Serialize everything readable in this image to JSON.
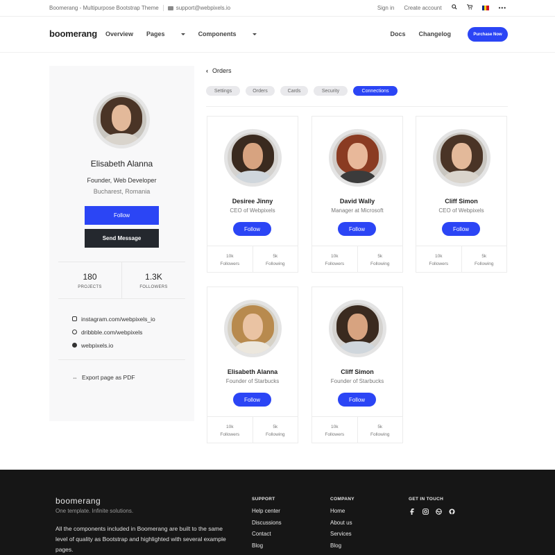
{
  "topbar": {
    "brand": "Boomerang - Multipurpose Bootstrap Theme",
    "email": "support@webpixels.io",
    "signin": "Sign in",
    "create": "Create account",
    "dots": "•••"
  },
  "navbar": {
    "logo": "boomerang",
    "links": [
      "Overview",
      "Pages",
      "Components"
    ],
    "right": [
      "Docs",
      "Changelog"
    ],
    "purchase": "Purchase Now"
  },
  "profile": {
    "name": "Elisabeth Alanna",
    "role": "Founder, Web Developer",
    "location": "Bucharest, Romania",
    "follow": "Follow",
    "message": "Send Message",
    "stats": [
      {
        "value": "180",
        "label": "PROJECTS"
      },
      {
        "value": "1.3K",
        "label": "FOLLOWERS"
      }
    ],
    "links": [
      "instagram.com/webpixels_io",
      "dribbble.com/webpixels",
      "webpixels.io"
    ],
    "export": "Export page as PDF"
  },
  "main": {
    "back": "Orders",
    "tabs": [
      "Settings",
      "Orders",
      "Cards",
      "Security",
      "Connections"
    ],
    "active_tab": "Connections",
    "cards": [
      {
        "name": "Desiree Jinny",
        "role": "CEO of Webpixels",
        "follow": "Follow",
        "followers": "10k",
        "followers_label": "Followers",
        "following": "5k",
        "following_label": "Following"
      },
      {
        "name": "David Wally",
        "role": "Manager at Microsoft",
        "follow": "Follow",
        "followers": "10k",
        "followers_label": "Followers",
        "following": "5k",
        "following_label": "Following"
      },
      {
        "name": "Cliff Simon",
        "role": "CEO of Webpixels",
        "follow": "Follow",
        "followers": "10k",
        "followers_label": "Followers",
        "following": "5k",
        "following_label": "Following"
      },
      {
        "name": "Elisabeth Alanna",
        "role": "Founder of Starbucks",
        "follow": "Follow",
        "followers": "10k",
        "followers_label": "Followers",
        "following": "5k",
        "following_label": "Following"
      },
      {
        "name": "Cliff Simon",
        "role": "Founder of Starbucks",
        "follow": "Follow",
        "followers": "10k",
        "followers_label": "Followers",
        "following": "5k",
        "following_label": "Following"
      }
    ]
  },
  "footer": {
    "logo": "boomerang",
    "tagline": "One template. Infinite solutions.",
    "description": "All the components included in Boomerang are built to the same level of quality as Bootstrap and highlighted with several example pages.",
    "support": {
      "heading": "SUPPORT",
      "items": [
        "Help center",
        "Discussions",
        "Contact",
        "Blog"
      ]
    },
    "company": {
      "heading": "COMPANY",
      "items": [
        "Home",
        "About us",
        "Services",
        "Blog"
      ]
    },
    "touch": {
      "heading": "GET IN TOUCH"
    }
  },
  "colors": {
    "accent": "#2b45f5",
    "dark_button": "#24282e",
    "footer": "#161616"
  },
  "icons": [
    "search-icon",
    "cart-icon",
    "flag-icon",
    "chevron-left-icon",
    "instagram-icon",
    "dribbble-icon",
    "globe-icon",
    "link-icon",
    "facebook-icon",
    "github-icon"
  ]
}
